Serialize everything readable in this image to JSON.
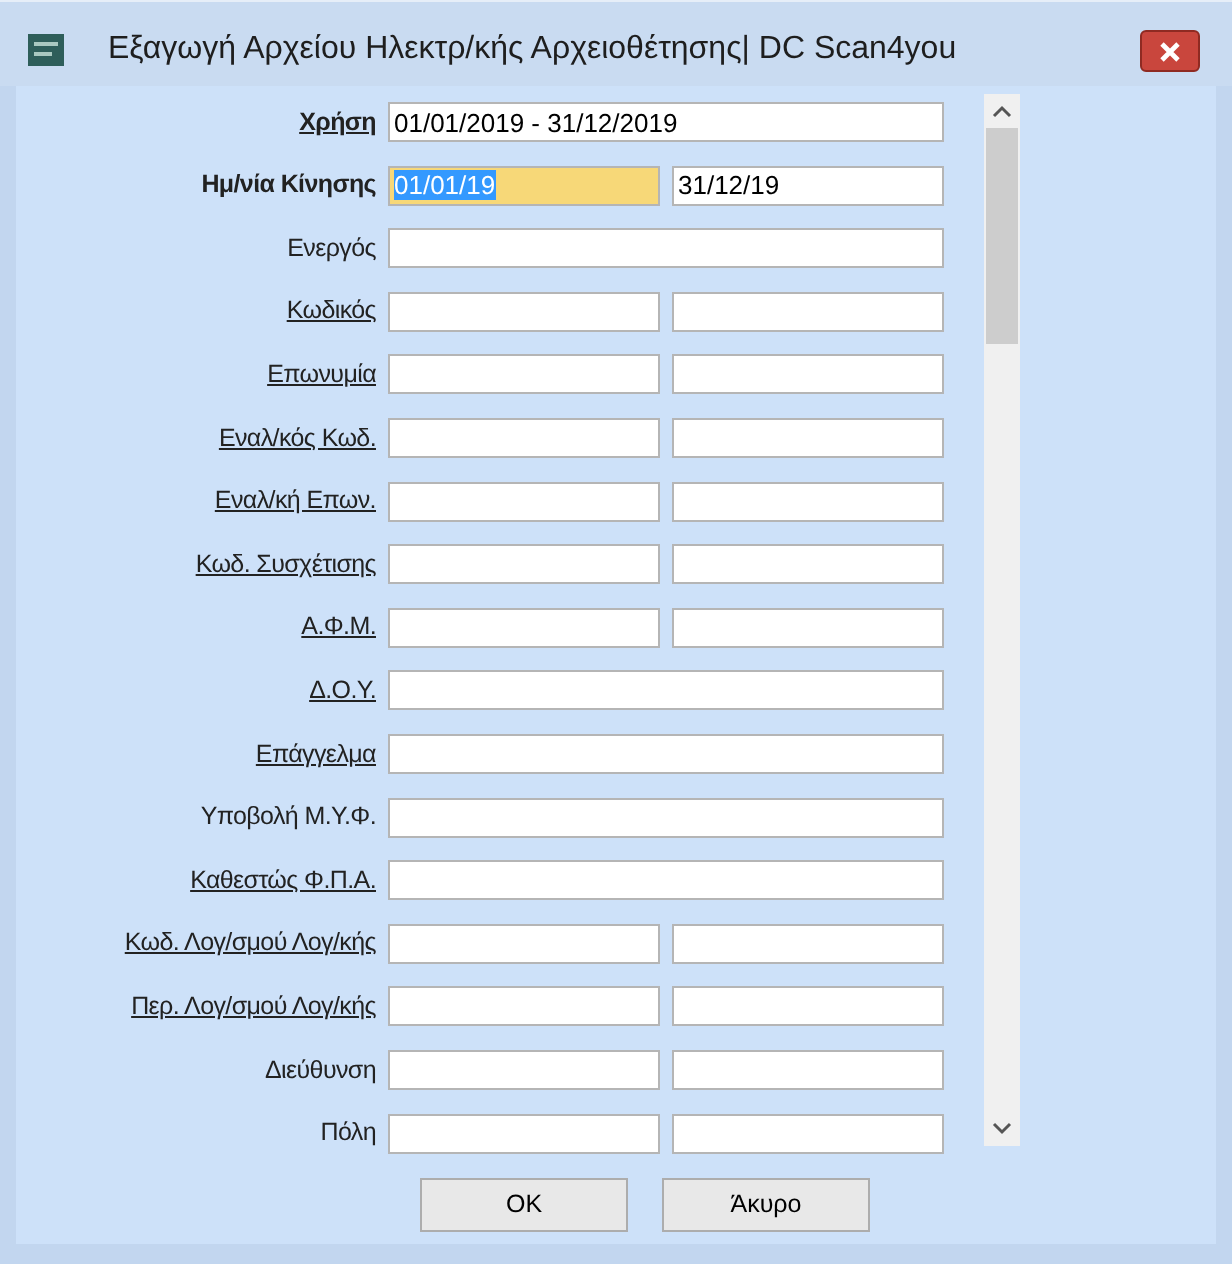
{
  "window": {
    "title": "Εξαγωγή Αρχείου Ηλεκτρ/κής Αρχειοθέτησης| DC Scan4you"
  },
  "rows": [
    {
      "label": "Χρήση",
      "bold": true,
      "underlined": true,
      "kind": "single",
      "fields": [
        {
          "value": "01/01/2019 - 31/12/2019",
          "selected": false
        }
      ]
    },
    {
      "label": "Ημ/νία Κίνησης",
      "bold": true,
      "underlined": false,
      "kind": "double",
      "fields": [
        {
          "value": "01/01/19",
          "selected": true
        },
        {
          "value": "31/12/19",
          "selected": false
        }
      ]
    },
    {
      "label": "Ενεργός",
      "bold": false,
      "underlined": false,
      "kind": "single"
    },
    {
      "label": "Κωδικός",
      "bold": false,
      "underlined": true,
      "kind": "double"
    },
    {
      "label": "Επωνυμία",
      "bold": false,
      "underlined": true,
      "kind": "double"
    },
    {
      "label": "Εναλ/κός Κωδ.",
      "bold": false,
      "underlined": true,
      "kind": "double"
    },
    {
      "label": "Εναλ/κή Επων.",
      "bold": false,
      "underlined": true,
      "kind": "double"
    },
    {
      "label": "Κωδ. Συσχέτισης",
      "bold": false,
      "underlined": true,
      "kind": "double"
    },
    {
      "label": "Α.Φ.Μ.",
      "bold": false,
      "underlined": true,
      "kind": "double"
    },
    {
      "label": "Δ.Ο.Υ.",
      "bold": false,
      "underlined": true,
      "kind": "single"
    },
    {
      "label": "Επάγγελμα",
      "bold": false,
      "underlined": true,
      "kind": "single"
    },
    {
      "label": "Υποβολή Μ.Υ.Φ.",
      "bold": false,
      "underlined": false,
      "kind": "single"
    },
    {
      "label": "Καθεστώς Φ.Π.Α.",
      "bold": false,
      "underlined": true,
      "kind": "single"
    },
    {
      "label": "Κωδ. Λογ/σμού Λογ/κής",
      "bold": false,
      "underlined": true,
      "kind": "double"
    },
    {
      "label": "Περ. Λογ/σμού Λογ/κής",
      "bold": false,
      "underlined": true,
      "kind": "double"
    },
    {
      "label": "Διεύθυνση",
      "bold": false,
      "underlined": false,
      "kind": "double"
    },
    {
      "label": "Πόλη",
      "bold": false,
      "underlined": false,
      "kind": "double"
    }
  ],
  "buttons": [
    "OK",
    "Άκυρο"
  ]
}
